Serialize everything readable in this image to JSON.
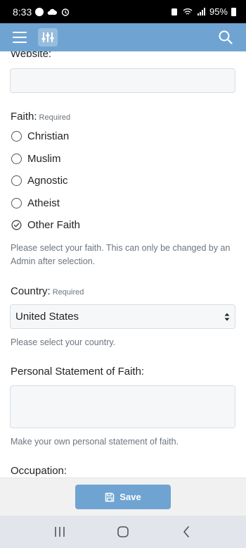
{
  "status_bar": {
    "time": "8:33",
    "battery": "95%"
  },
  "icons": {
    "menu": "menu-icon",
    "filter": "sliders-icon",
    "search": "search-icon",
    "save": "floppy-disk-icon"
  },
  "colors": {
    "accent": "#6fa4d2",
    "help_text": "#6c757d"
  },
  "form": {
    "website": {
      "label": "Website:",
      "value": ""
    },
    "faith": {
      "label": "Faith:",
      "required": "Required",
      "options": [
        "Christian",
        "Muslim",
        "Agnostic",
        "Atheist",
        "Other Faith"
      ],
      "selected": "Other Faith",
      "help": "Please select your faith. This can only be changed by an Admin after selection."
    },
    "country": {
      "label": "Country:",
      "required": "Required",
      "value": "United States",
      "help": "Please select your country."
    },
    "statement": {
      "label": "Personal Statement of Faith:",
      "value": "",
      "help": "Make your own personal statement of faith."
    },
    "occupation": {
      "label": "Occupation:"
    }
  },
  "actions": {
    "save_label": "Save"
  }
}
